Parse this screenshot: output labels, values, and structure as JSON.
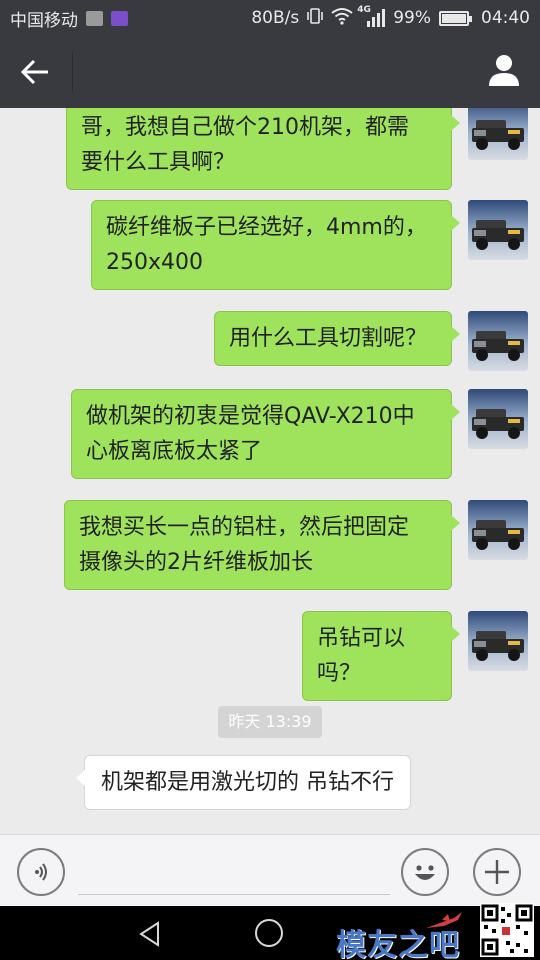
{
  "status_bar": {
    "carrier": "中国移动",
    "speed": "80B/s",
    "network": "4G",
    "battery": "99%",
    "battery_level": 0.99,
    "time": "04:40",
    "icons": [
      "gallery-icon",
      "app-notification-icon",
      "vibrate-icon",
      "wifi-icon",
      "signal-icon",
      "battery-icon"
    ]
  },
  "title_bar": {
    "icons": [
      "back-arrow-icon",
      "profile-icon"
    ]
  },
  "messages": [
    {
      "side": "sent",
      "lines": [
        "哥，我想自己做个210机架，都需",
        "要什么工具啊？"
      ]
    },
    {
      "side": "sent",
      "lines": [
        "碳纤维板子已经选好，4mm的，",
        "250x400"
      ]
    },
    {
      "side": "sent",
      "lines": [
        "用什么工具切割呢？"
      ]
    },
    {
      "side": "sent",
      "lines": [
        "做机架的初衷是觉得QAV-X210中",
        "心板离底板太紧了"
      ]
    },
    {
      "side": "sent",
      "lines": [
        "我想买长一点的铝柱，然后把固定",
        "摄像头的2片纤维板加长"
      ]
    },
    {
      "side": "sent",
      "lines": [
        "吊钻可以吗？"
      ]
    }
  ],
  "timestamp": "昨天 13:39",
  "received_message": "机架都是用激光切的  吊钻不行",
  "input_bar": {
    "value": "",
    "icons": [
      "voice-icon",
      "emoji-icon",
      "plus-icon"
    ]
  },
  "nav_bar": {
    "icons": [
      "nav-back-icon",
      "nav-home-icon"
    ],
    "watermark": "模友之吧"
  },
  "colors": {
    "header": "#393a3f",
    "sent_bubble": "#9fe35d",
    "received_bubble": "#ffffff",
    "chat_background": "#ebebeb"
  }
}
